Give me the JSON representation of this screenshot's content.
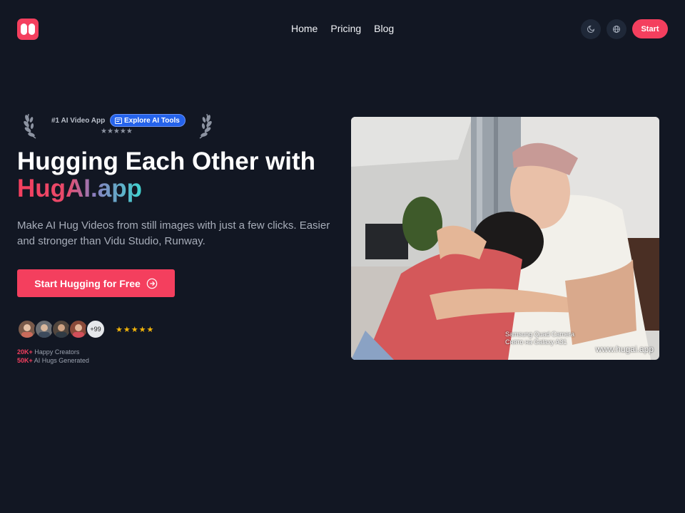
{
  "header": {
    "nav": [
      "Home",
      "Pricing",
      "Blog"
    ],
    "theme_icon": "moon-icon",
    "lang_icon": "globe-icon",
    "start_label": "Start"
  },
  "award": {
    "label": "#1 AI Video App",
    "explore_label": "Explore AI Tools",
    "stars": "★★★★★"
  },
  "hero": {
    "title_line1": "Hugging Each Other with",
    "title_line2": "HugAI.app",
    "subtitle": "Make AI Hug Videos from still images with just a few clicks. Easier and stronger than Vidu Studio, Runway.",
    "cta_label": "Start Hugging for Free"
  },
  "social_proof": {
    "more_count": "+99",
    "stars": "★★★★★",
    "creators_count": "20K+",
    "creators_label": "Happy Creators",
    "hugs_count": "50K+",
    "hugs_label": "AI Hugs Generated"
  },
  "video": {
    "camera_line1": "Samsung Quad Camera",
    "camera_line2": "Снято на Galaxy A31",
    "watermark": "www.hugai.app"
  },
  "colors": {
    "accent": "#f43f5e",
    "background": "#121723",
    "pill": "#2563eb"
  }
}
